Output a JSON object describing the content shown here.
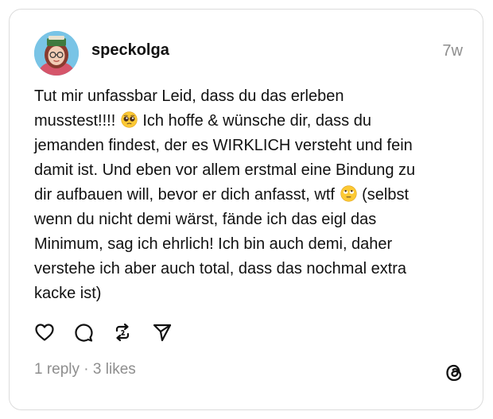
{
  "post": {
    "username": "speckolga",
    "timestamp": "7w",
    "lines": [
      [
        "Tut mir unfassbar Leid, dass du das erleben",
        "",
        ""
      ],
      [
        "musstest!!!! ",
        "pleading-face",
        " Ich hoffe & wünsche dir, dass du"
      ],
      [
        "jemanden findest, der es WIRKLICH versteht und fein",
        "",
        ""
      ],
      [
        "damit ist. Und eben vor allem erstmal eine Bindung zu",
        "",
        ""
      ],
      [
        "dir aufbauen will, bevor er dich anfasst, wtf ",
        "eye-roll-face",
        " (selbst"
      ],
      [
        "wenn du nicht demi wärst, fände ich das eigl das",
        "",
        ""
      ],
      [
        "Minimum, sag ich ehrlich! Ich bin auch demi, daher",
        "",
        ""
      ],
      [
        "verstehe ich aber auch total, dass das nochmal extra",
        "",
        ""
      ],
      [
        "kacke ist)",
        "",
        ""
      ]
    ]
  },
  "stats": {
    "replies": "1 reply",
    "separator": " · ",
    "likes": "3 likes"
  },
  "icons": {
    "like": "heart-icon",
    "reply": "comment-icon",
    "repost": "repost-icon",
    "share": "share-icon",
    "brand": "threads-logo-icon"
  },
  "colors": {
    "text": "#111111",
    "muted": "#8e8e8e",
    "border": "#dcdcdc"
  }
}
